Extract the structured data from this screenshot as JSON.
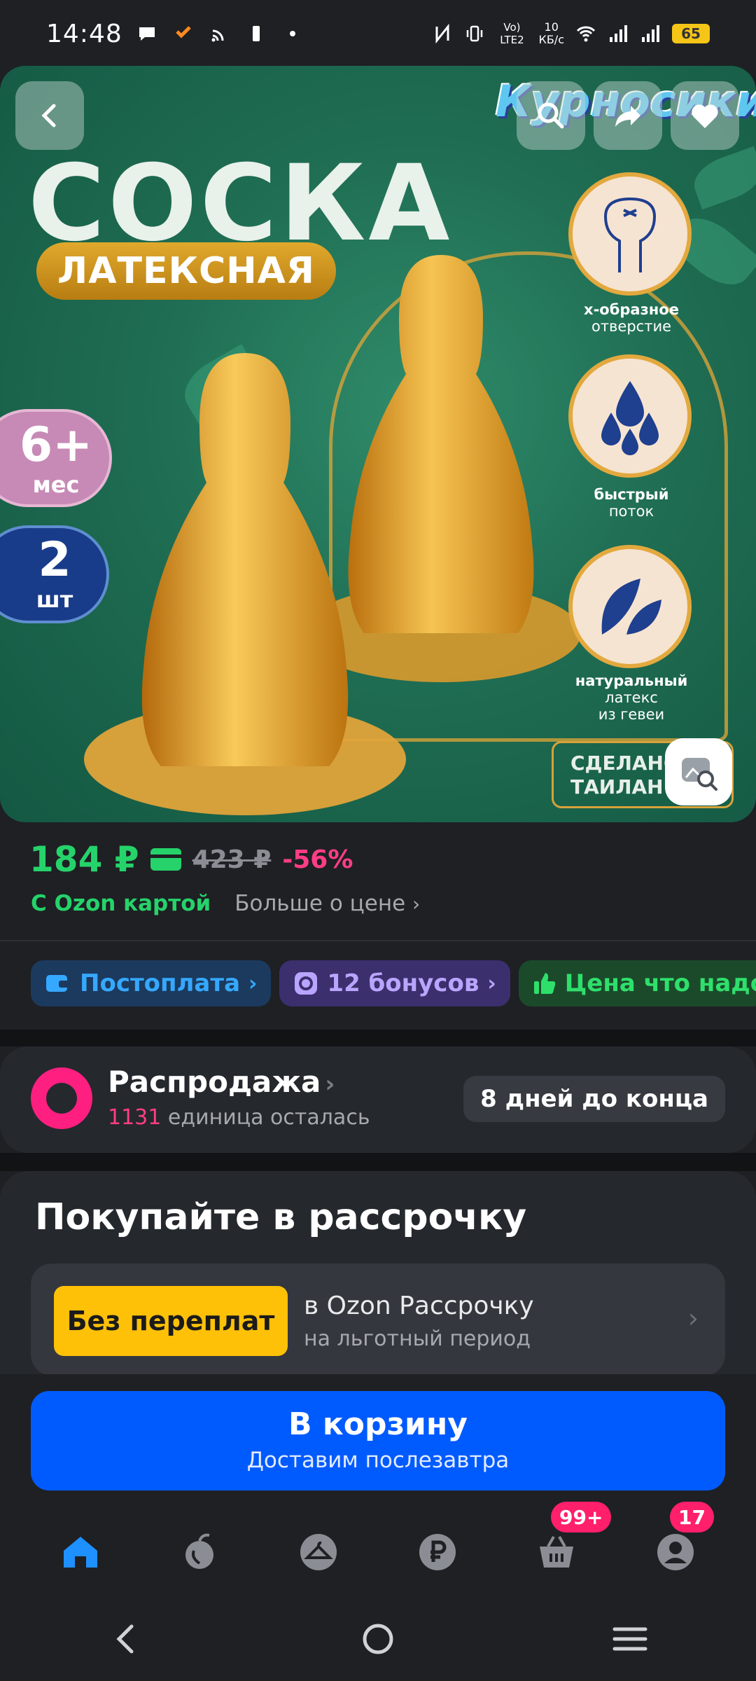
{
  "status_bar": {
    "time": "14:48",
    "net_speed_value": "10",
    "net_speed_unit": "КБ/с",
    "network_label": "Vo) LTE2",
    "battery": "65"
  },
  "hero": {
    "title": "СОСКА",
    "subtitle": "ЛАТЕКСНАЯ",
    "brand": "Курносики",
    "age_big": "6+",
    "age_small": "мес",
    "qty_big": "2",
    "qty_small": "шт",
    "features": [
      {
        "line1": "х-образное",
        "line2": "отверстие",
        "line3": ""
      },
      {
        "line1": "быстрый",
        "line2": "поток",
        "line3": ""
      },
      {
        "line1": "натуральный",
        "line2": "латекс",
        "line3": "из гевеи"
      }
    ],
    "made_in_line1": "СДЕЛАНО",
    "made_in_line2": "ТАИЛАН"
  },
  "price": {
    "current": "184 ₽",
    "old": "423 ₽",
    "discount": "-56%",
    "ozon_card": "С Ozon картой",
    "more": "Больше о цене"
  },
  "chips": [
    {
      "label": "Постоплата"
    },
    {
      "label": "12 бонусов"
    },
    {
      "label": "Цена что надо"
    }
  ],
  "sale": {
    "title": "Распродажа",
    "count": "1131",
    "remaining": "единица осталась",
    "timer": "8 дней до конца"
  },
  "installments": {
    "title": "Покупайте в рассрочку",
    "badge": "Без переплат",
    "line1": "в Ozon Рассрочку",
    "line2": "на льготный период"
  },
  "cart": {
    "label": "В корзину",
    "sub": "Доставим послезавтра"
  },
  "bottom_nav": {
    "cart_badge": "99+",
    "profile_badge": "17"
  },
  "colors": {
    "accent_green": "#25d36a",
    "accent_blue": "#005bff",
    "accent_pink": "#ff1f80",
    "badge_yellow": "#ffc107"
  }
}
